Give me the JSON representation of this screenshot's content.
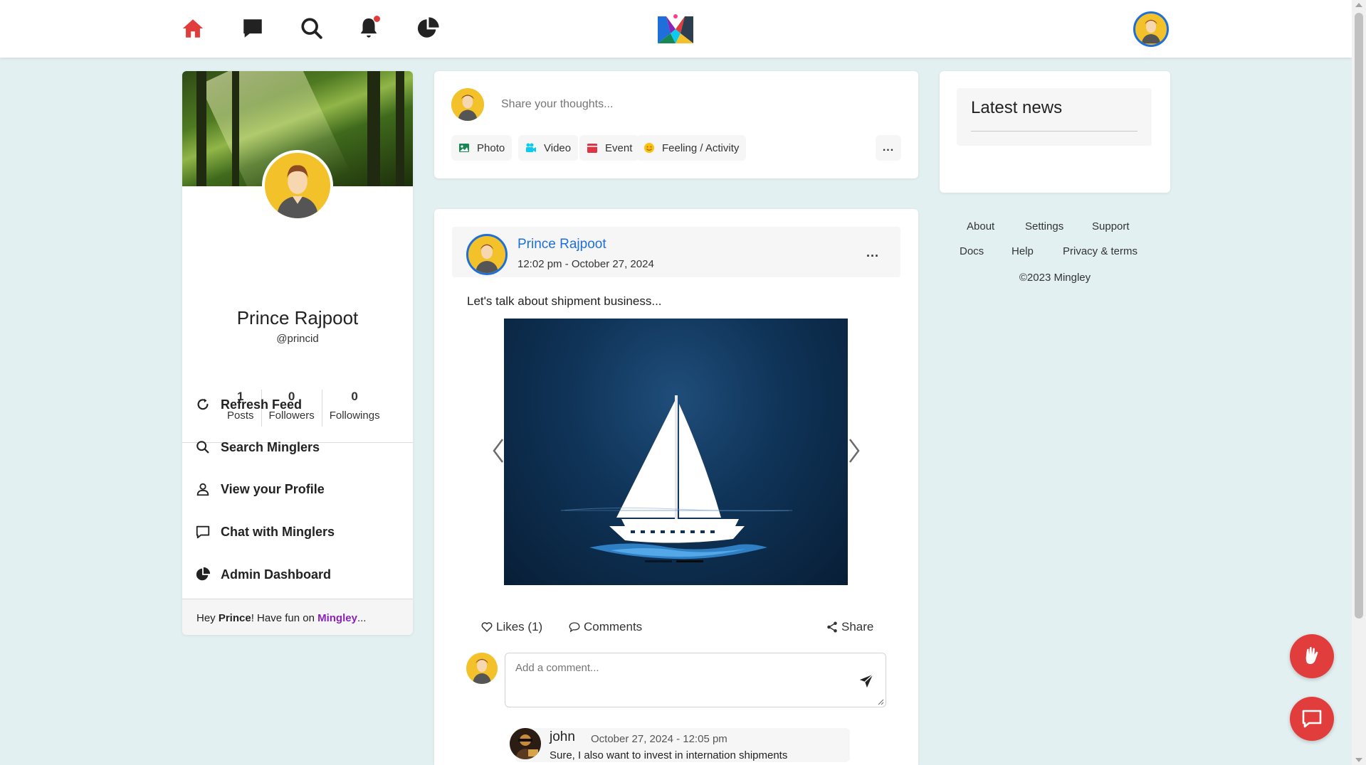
{
  "nav": {
    "icons": [
      "home-icon",
      "chat-icon",
      "search-icon",
      "bell-icon",
      "pie-chart-icon"
    ],
    "active_color": "#e23d3d",
    "icon_color": "#222222"
  },
  "profile": {
    "name": "Prince Rajpoot",
    "handle": "@princid",
    "stats": [
      {
        "value": "1",
        "label": "Posts"
      },
      {
        "value": "0",
        "label": "Followers"
      },
      {
        "value": "0",
        "label": "Followings"
      }
    ],
    "menu": [
      {
        "icon": "refresh-icon",
        "label": "Refresh Feed"
      },
      {
        "icon": "search-icon",
        "label": "Search Minglers"
      },
      {
        "icon": "user-icon",
        "label": "View your Profile"
      },
      {
        "icon": "chat-icon",
        "label": "Chat with Minglers"
      },
      {
        "icon": "pie-chart-icon",
        "label": "Admin Dashboard"
      }
    ],
    "footer": {
      "prefix": "Hey ",
      "name": "Prince",
      "middle": "! Have fun on ",
      "brand": "Mingley",
      "suffix": "..."
    }
  },
  "composer": {
    "placeholder": "Share your thoughts...",
    "buttons": [
      {
        "icon": "image-icon",
        "label": "Photo",
        "color": "#198754"
      },
      {
        "icon": "video-icon",
        "label": "Video",
        "color": "#0dcaf0"
      },
      {
        "icon": "calendar-icon",
        "label": "Event",
        "color": "#dc3545"
      },
      {
        "icon": "smile-icon",
        "label": "Feeling / Activity",
        "color": "#ffc107"
      }
    ],
    "more_label": "..."
  },
  "post": {
    "author": "Prince Rajpoot",
    "time": "12:02 pm - October 27, 2024",
    "more_label": "...",
    "text": "Let's talk about shipment business...",
    "likes_label": "Likes (1)",
    "comments_label": "Comments",
    "share_label": "Share",
    "comment_placeholder": "Add a comment...",
    "reply": {
      "name": "john",
      "time": "October 27, 2024 - 12:05 pm",
      "text": "Sure, I also want to invest in internation shipments"
    }
  },
  "news": {
    "title": "Latest news"
  },
  "footer_links": {
    "row1": [
      "About",
      "Settings",
      "Support"
    ],
    "row2": [
      "Docs",
      "Help",
      "Privacy & terms"
    ],
    "copyright": "©2023 Mingley"
  }
}
